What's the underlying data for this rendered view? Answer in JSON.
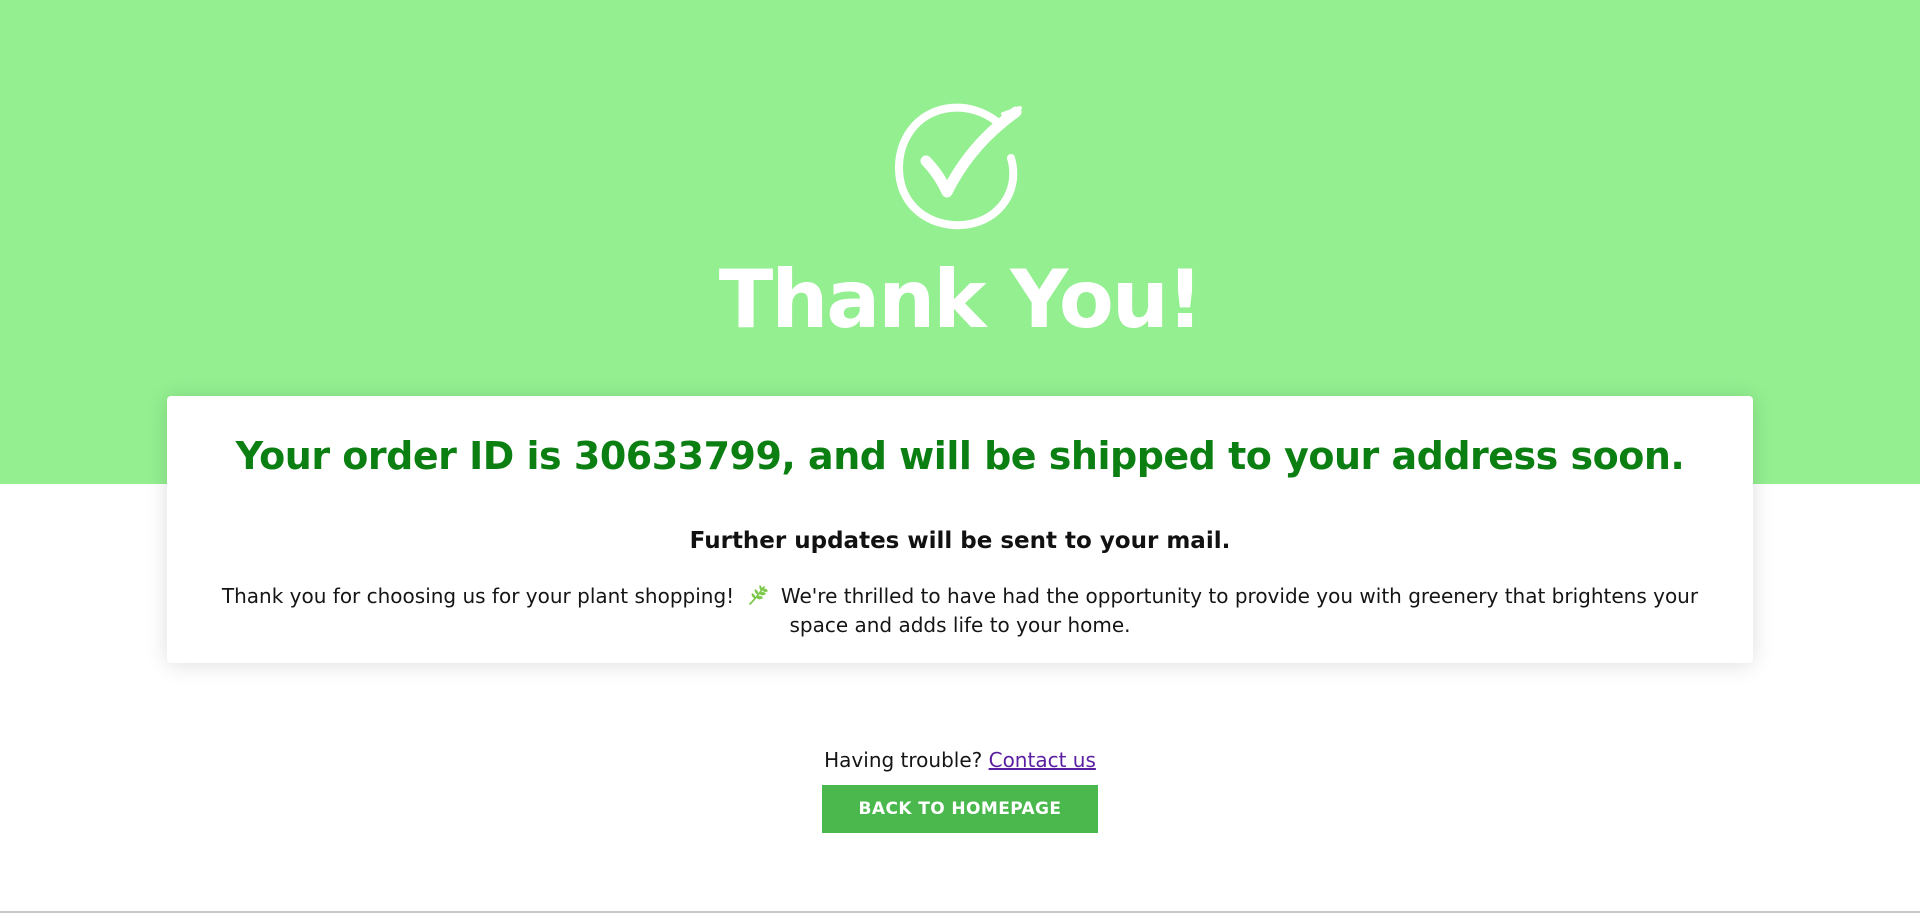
{
  "hero": {
    "title": "Thank You!",
    "icon": "check-circle-icon",
    "background_color": "#93ef90"
  },
  "order_card": {
    "heading": "Your order ID is 30633799, and will be shipped to your address soon.",
    "updates": "Further updates will be sent to your mail.",
    "message_before_icon": "Thank you for choosing us for your plant shopping!",
    "message_icon": "leaf-icon",
    "message_after_icon": "We're thrilled to have had the opportunity to provide you with greenery that brightens your space and adds life to your home.",
    "heading_color": "#0b7f12"
  },
  "support": {
    "prompt": "Having trouble?",
    "link_label": "Contact us"
  },
  "actions": {
    "home_button_label": "BACK TO HOMEPAGE",
    "button_color": "#4bb84e"
  }
}
